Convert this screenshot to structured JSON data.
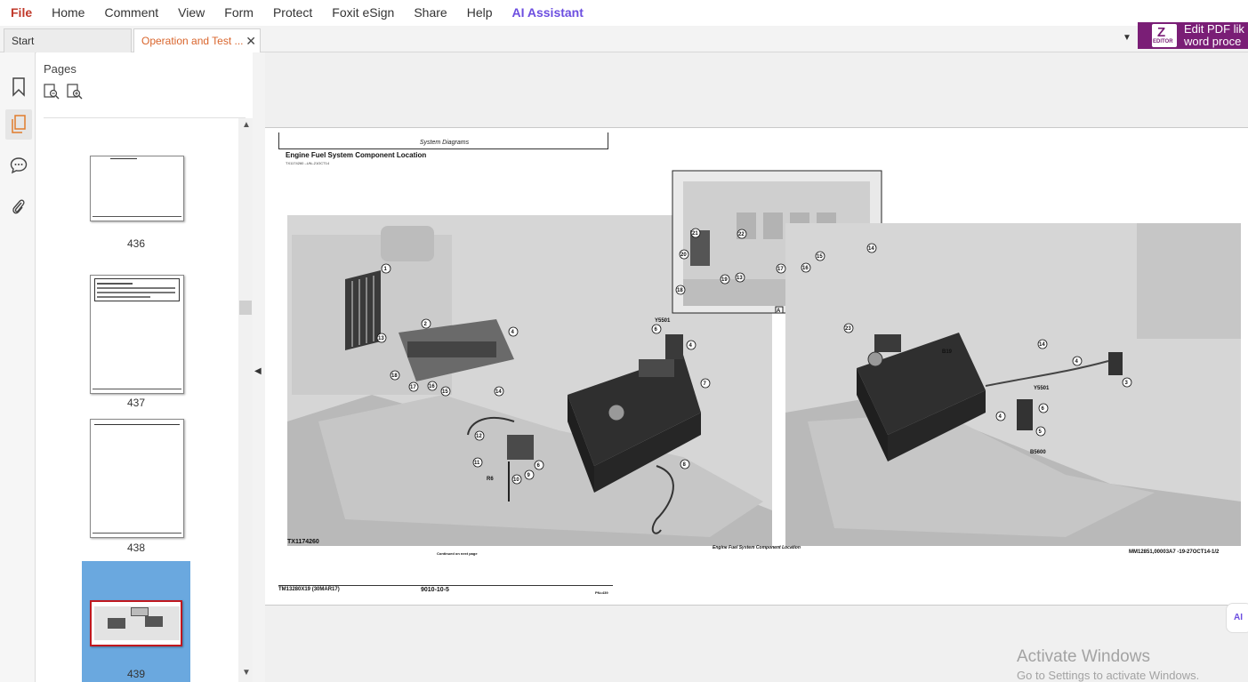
{
  "menu": {
    "items": [
      "File",
      "Home",
      "Comment",
      "View",
      "Form",
      "Protect",
      "Foxit eSign",
      "Share",
      "Help",
      "AI Assistant"
    ]
  },
  "tabs": {
    "start_label": "Start",
    "active_label": "Operation and Test ...",
    "close_glyph": "✕",
    "dropdown_glyph": "▼"
  },
  "promo": {
    "line1": "Edit PDF lik",
    "line2": "word proce",
    "logo_mark": "Z",
    "logo_text": "EDITOR",
    "color": "#7a1e76"
  },
  "rail": {
    "icons": [
      "bookmark-icon",
      "pages-icon",
      "comment-icon",
      "attachment-icon"
    ],
    "active": "pages-icon"
  },
  "pages_panel": {
    "title": "Pages",
    "thumbnails": [
      {
        "label": "436"
      },
      {
        "label": "437"
      },
      {
        "label": "438"
      },
      {
        "label": "439",
        "selected": true
      }
    ],
    "selection_color": "#6aa8df"
  },
  "document": {
    "header": "System Diagrams",
    "title": "Engine Fuel System Component Location",
    "subtitle": "TX1174260 –UN–21OCT14",
    "figure_id": "TX1174260",
    "continued": "Continued on next page",
    "caption": "Engine Fuel System Component Location",
    "ref": "MM12851,00003A7 -19-27OCT14-1/2",
    "footer_left": "TM13280X19 (30MAR17)",
    "footer_mid": "9010-10-5",
    "footer_right": "PN=439",
    "callouts_left": [
      "1",
      "2",
      "13",
      "18",
      "17",
      "16",
      "15",
      "14",
      "4",
      "6",
      "4",
      "7",
      "12",
      "11",
      "10",
      "9",
      "6",
      "8"
    ],
    "callouts_inset": [
      "21",
      "22",
      "20",
      "18",
      "19",
      "13",
      "17",
      "16",
      "15",
      "14"
    ],
    "callouts_right": [
      "23",
      "14",
      "4",
      "3",
      "6",
      "5",
      "4"
    ],
    "tags": [
      "Y5501",
      "R6",
      "B19",
      "Y5501",
      "B5600",
      "A"
    ]
  },
  "floating": {
    "label": "AI"
  },
  "watermark": {
    "title": "Activate Windows",
    "subtitle": "Go to Settings to activate Windows."
  }
}
